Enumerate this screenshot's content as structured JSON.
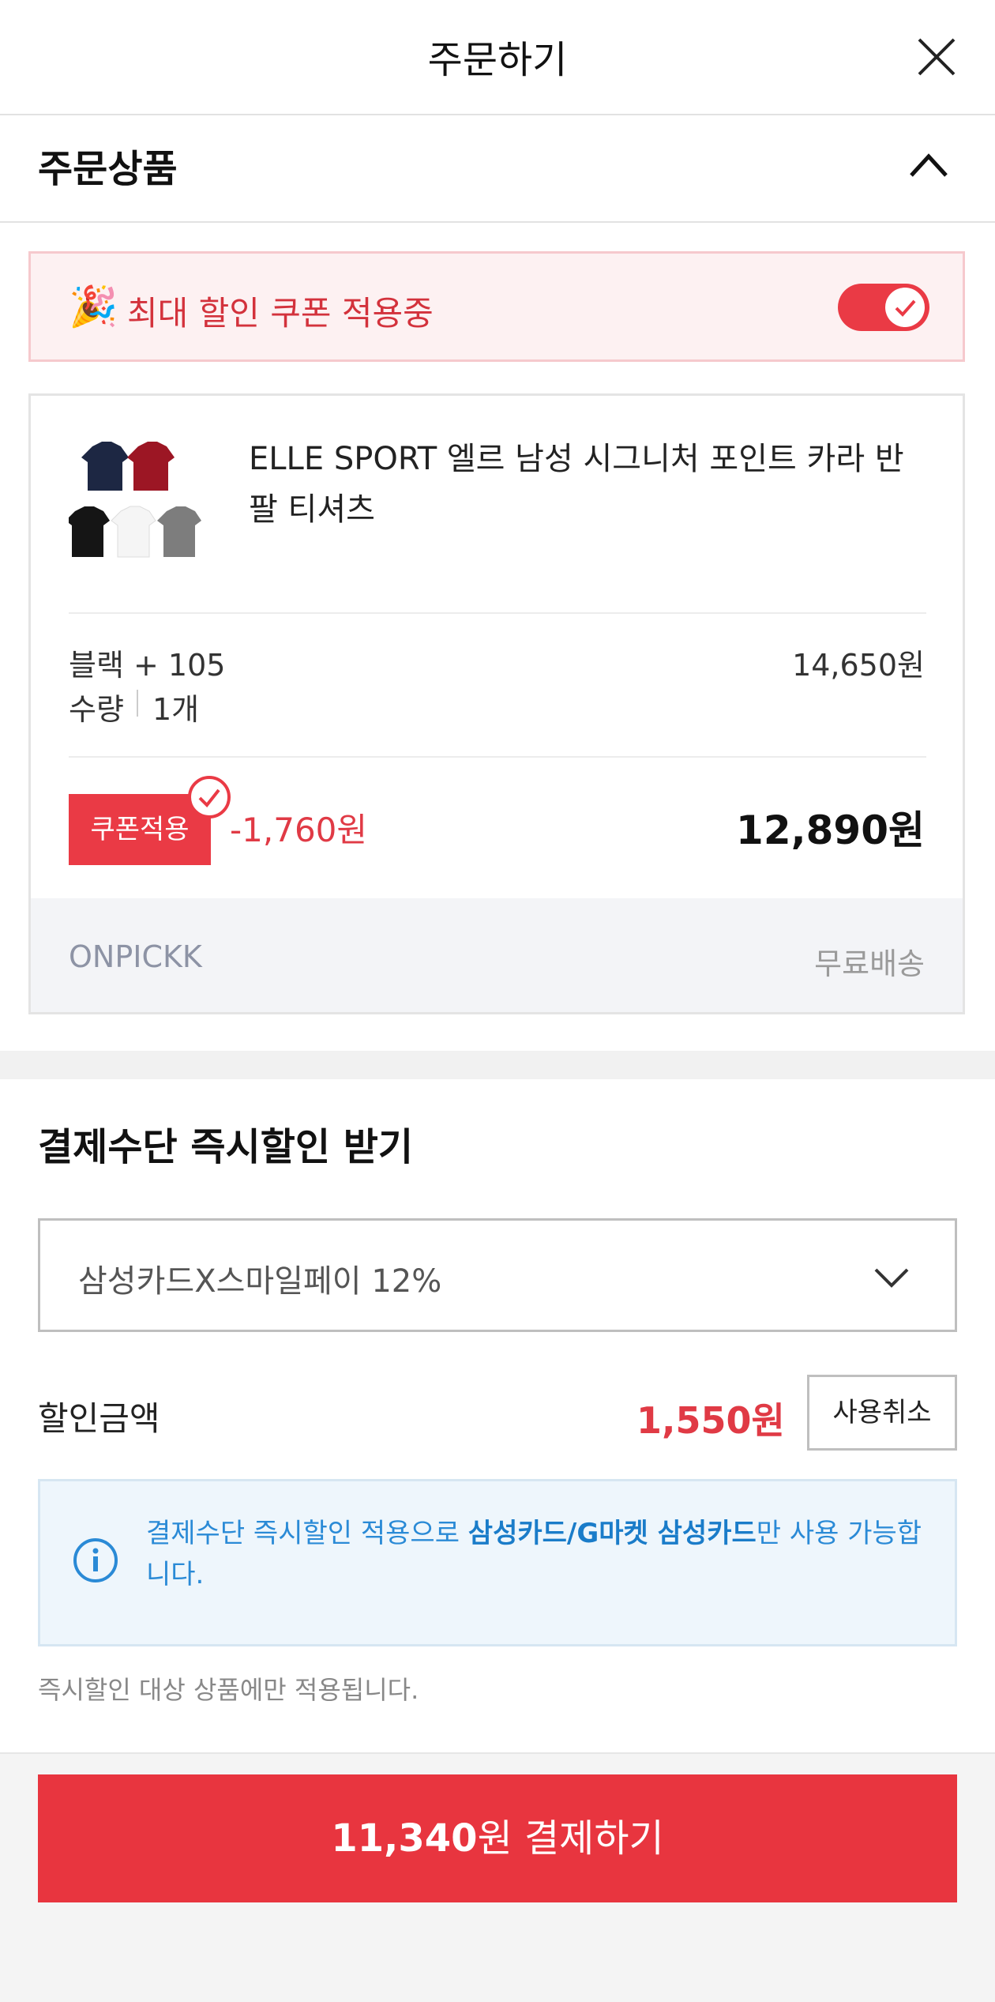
{
  "header": {
    "title": "주문하기"
  },
  "order_section": {
    "title": "주문상품"
  },
  "coupon_banner": {
    "text": "최대 할인 쿠폰 적용중",
    "toggle_on": true
  },
  "product": {
    "name": "ELLE SPORT 엘르 남성 시그니처 포인트 카라 반팔 티셔츠",
    "option": "블랙 + 105",
    "qty_label": "수량",
    "qty_value": "1개",
    "option_price": "14,650원",
    "coupon_badge": "쿠폰적용",
    "discount": "-1,760원",
    "final_price": "12,890원",
    "seller": "ONPICKK",
    "shipping": "무료배송"
  },
  "payment": {
    "title": "결제수단 즉시할인 받기",
    "selected_method": "삼성카드X스마일페이 12%",
    "discount_label": "할인금액",
    "discount_amount": "1,550원",
    "cancel_label": "사용취소",
    "info_prefix": "결제수단 즉시할인 적용으로 ",
    "info_bold": "삼성카드/G마켓 삼성카드",
    "info_suffix": "만 사용 가능합니다.",
    "note": "즉시할인 대상 상품에만 적용됩니다."
  },
  "checkout": {
    "amount": "11,340",
    "suffix": "원 결제하기"
  },
  "colors": {
    "accent": "#e8353f",
    "info_blue": "#2a8ad6"
  }
}
